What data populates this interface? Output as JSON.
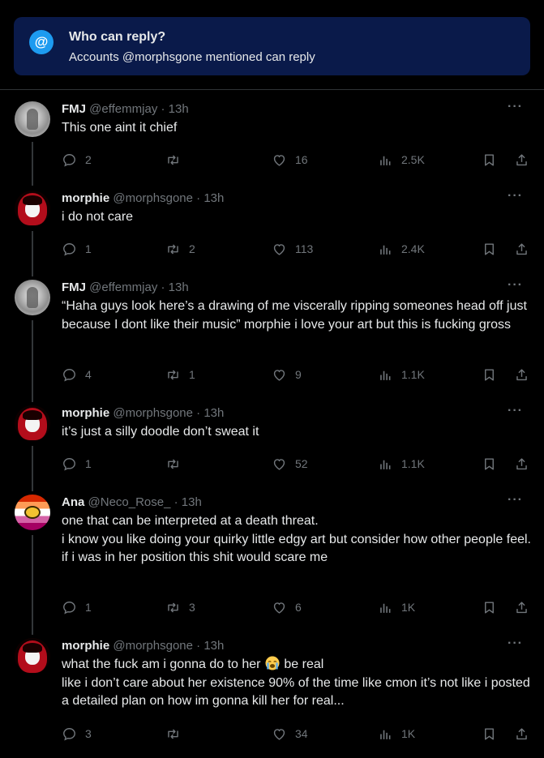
{
  "banner": {
    "title": "Who can reply?",
    "subtitle": "Accounts @morphsgone mentioned can reply",
    "icon_label": "@"
  },
  "tweets": [
    {
      "name": "FMJ",
      "handle": "@effemmjay",
      "time": "· 13h",
      "avatar": "fmj",
      "text": "This one aint it chief",
      "replies": "2",
      "reposts": "",
      "likes": "16",
      "views": "2.5K"
    },
    {
      "name": "morphie",
      "handle": "@morphsgone",
      "time": "· 13h",
      "avatar": "morphie",
      "text": "i do not care",
      "replies": "1",
      "reposts": "2",
      "likes": "113",
      "views": "2.4K"
    },
    {
      "name": "FMJ",
      "handle": "@effemmjay",
      "time": "· 13h",
      "avatar": "fmj",
      "text": "“Haha guys look here’s a drawing of me viscerally ripping someones head off just because I dont like their music” morphie i love your art but this is fucking gross",
      "replies": "4",
      "reposts": "1",
      "likes": "9",
      "views": "1.1K"
    },
    {
      "name": "morphie",
      "handle": "@morphsgone",
      "time": "· 13h",
      "avatar": "morphie",
      "text": "it’s just a silly doodle don’t sweat it",
      "replies": "1",
      "reposts": "",
      "likes": "52",
      "views": "1.1K"
    },
    {
      "name": "Ana",
      "handle": "@Neco_Rose_",
      "time": " · 13h",
      "avatar": "ana",
      "text": "one that can be interpreted at a death threat.\ni know you like doing your quirky little edgy art but consider how other people feel.\nif i was in her position this shit would scare me",
      "replies": "1",
      "reposts": "3",
      "likes": "6",
      "views": "1K"
    },
    {
      "name": "morphie",
      "handle": "@morphsgone",
      "time": "· 13h",
      "avatar": "morphie",
      "text_before_emoji": "what the fuck am i gonna do to her ",
      "emoji": "loudly-crying-face-emoji",
      "text_after_emoji": " be real\nlike i don’t care about her existence 90% of the time like cmon it’s not like i posted a detailed plan on how im gonna kill her for real...",
      "replies": "3",
      "reposts": "",
      "likes": "34",
      "views": "1K"
    }
  ],
  "colors": {
    "background": "#000000",
    "banner_bg": "#0a1a4a",
    "accent": "#1d9bf0",
    "muted": "#71767b",
    "text": "#e7e9ea"
  }
}
